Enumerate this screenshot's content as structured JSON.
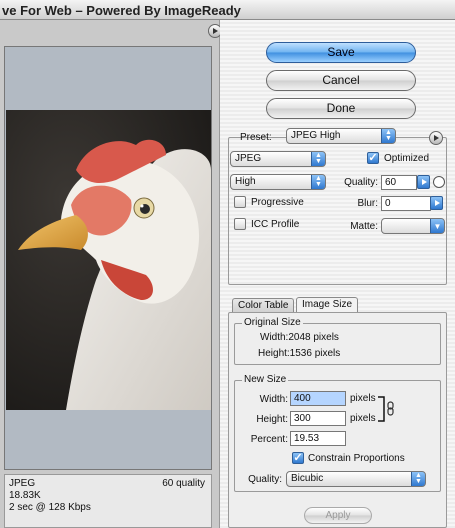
{
  "window": {
    "title": "ve For Web – Powered By ImageReady"
  },
  "preview": {
    "format": "JPEG",
    "size": "18.83K",
    "time": "2 sec @ 128 Kbps",
    "quality_label": "60 quality"
  },
  "buttons": {
    "save": "Save",
    "cancel": "Cancel",
    "done": "Done",
    "apply": "Apply"
  },
  "settings": {
    "preset_label": "Preset:",
    "preset_value": "JPEG High",
    "format_value": "JPEG",
    "compression_value": "High",
    "optimized_label": "Optimized",
    "optimized_checked": true,
    "quality_label": "Quality:",
    "quality_value": "60",
    "progressive_label": "Progressive",
    "progressive_checked": false,
    "blur_label": "Blur:",
    "blur_value": "0",
    "icc_label": "ICC Profile",
    "icc_checked": false,
    "matte_label": "Matte:",
    "matte_value": ""
  },
  "tabs": [
    {
      "label": "Color Table",
      "active": false
    },
    {
      "label": "Image Size",
      "active": true
    }
  ],
  "image_size": {
    "original_title": "Original Size",
    "original_width": "Width:2048 pixels",
    "original_height": "Height:1536 pixels",
    "new_title": "New Size",
    "width_label": "Width:",
    "width_value": "400",
    "height_label": "Height:",
    "height_value": "300",
    "pixels_unit": "pixels",
    "percent_label": "Percent:",
    "percent_value": "19.53",
    "constrain_label": "Constrain Proportions",
    "constrain_checked": true,
    "quality_label": "Quality:",
    "quality_value": "Bicubic"
  },
  "colors": {
    "accent": "#3f8fe0",
    "canvas": "#b2bac3"
  }
}
